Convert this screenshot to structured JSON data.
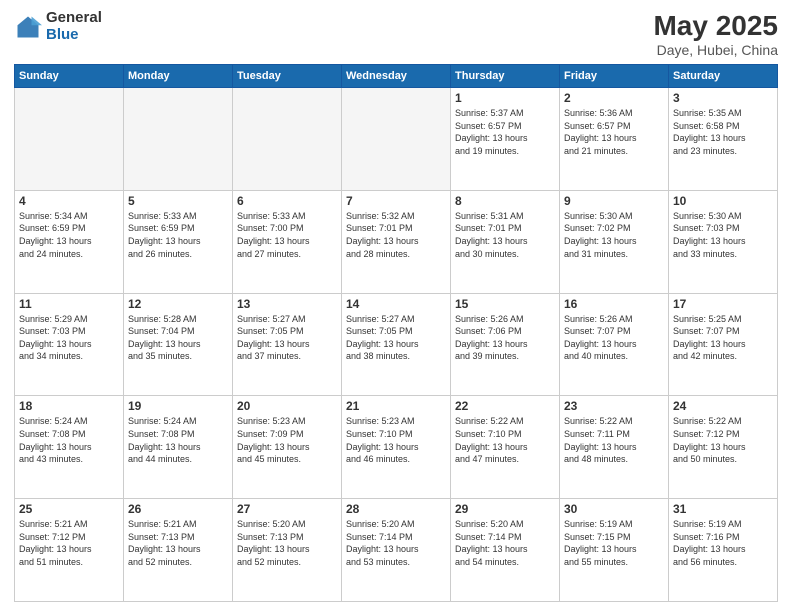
{
  "logo": {
    "general": "General",
    "blue": "Blue"
  },
  "title": "May 2025",
  "subtitle": "Daye, Hubei, China",
  "headers": [
    "Sunday",
    "Monday",
    "Tuesday",
    "Wednesday",
    "Thursday",
    "Friday",
    "Saturday"
  ],
  "weeks": [
    [
      {
        "num": "",
        "info": ""
      },
      {
        "num": "",
        "info": ""
      },
      {
        "num": "",
        "info": ""
      },
      {
        "num": "",
        "info": ""
      },
      {
        "num": "1",
        "info": "Sunrise: 5:37 AM\nSunset: 6:57 PM\nDaylight: 13 hours\nand 19 minutes."
      },
      {
        "num": "2",
        "info": "Sunrise: 5:36 AM\nSunset: 6:57 PM\nDaylight: 13 hours\nand 21 minutes."
      },
      {
        "num": "3",
        "info": "Sunrise: 5:35 AM\nSunset: 6:58 PM\nDaylight: 13 hours\nand 23 minutes."
      }
    ],
    [
      {
        "num": "4",
        "info": "Sunrise: 5:34 AM\nSunset: 6:59 PM\nDaylight: 13 hours\nand 24 minutes."
      },
      {
        "num": "5",
        "info": "Sunrise: 5:33 AM\nSunset: 6:59 PM\nDaylight: 13 hours\nand 26 minutes."
      },
      {
        "num": "6",
        "info": "Sunrise: 5:33 AM\nSunset: 7:00 PM\nDaylight: 13 hours\nand 27 minutes."
      },
      {
        "num": "7",
        "info": "Sunrise: 5:32 AM\nSunset: 7:01 PM\nDaylight: 13 hours\nand 28 minutes."
      },
      {
        "num": "8",
        "info": "Sunrise: 5:31 AM\nSunset: 7:01 PM\nDaylight: 13 hours\nand 30 minutes."
      },
      {
        "num": "9",
        "info": "Sunrise: 5:30 AM\nSunset: 7:02 PM\nDaylight: 13 hours\nand 31 minutes."
      },
      {
        "num": "10",
        "info": "Sunrise: 5:30 AM\nSunset: 7:03 PM\nDaylight: 13 hours\nand 33 minutes."
      }
    ],
    [
      {
        "num": "11",
        "info": "Sunrise: 5:29 AM\nSunset: 7:03 PM\nDaylight: 13 hours\nand 34 minutes."
      },
      {
        "num": "12",
        "info": "Sunrise: 5:28 AM\nSunset: 7:04 PM\nDaylight: 13 hours\nand 35 minutes."
      },
      {
        "num": "13",
        "info": "Sunrise: 5:27 AM\nSunset: 7:05 PM\nDaylight: 13 hours\nand 37 minutes."
      },
      {
        "num": "14",
        "info": "Sunrise: 5:27 AM\nSunset: 7:05 PM\nDaylight: 13 hours\nand 38 minutes."
      },
      {
        "num": "15",
        "info": "Sunrise: 5:26 AM\nSunset: 7:06 PM\nDaylight: 13 hours\nand 39 minutes."
      },
      {
        "num": "16",
        "info": "Sunrise: 5:26 AM\nSunset: 7:07 PM\nDaylight: 13 hours\nand 40 minutes."
      },
      {
        "num": "17",
        "info": "Sunrise: 5:25 AM\nSunset: 7:07 PM\nDaylight: 13 hours\nand 42 minutes."
      }
    ],
    [
      {
        "num": "18",
        "info": "Sunrise: 5:24 AM\nSunset: 7:08 PM\nDaylight: 13 hours\nand 43 minutes."
      },
      {
        "num": "19",
        "info": "Sunrise: 5:24 AM\nSunset: 7:08 PM\nDaylight: 13 hours\nand 44 minutes."
      },
      {
        "num": "20",
        "info": "Sunrise: 5:23 AM\nSunset: 7:09 PM\nDaylight: 13 hours\nand 45 minutes."
      },
      {
        "num": "21",
        "info": "Sunrise: 5:23 AM\nSunset: 7:10 PM\nDaylight: 13 hours\nand 46 minutes."
      },
      {
        "num": "22",
        "info": "Sunrise: 5:22 AM\nSunset: 7:10 PM\nDaylight: 13 hours\nand 47 minutes."
      },
      {
        "num": "23",
        "info": "Sunrise: 5:22 AM\nSunset: 7:11 PM\nDaylight: 13 hours\nand 48 minutes."
      },
      {
        "num": "24",
        "info": "Sunrise: 5:22 AM\nSunset: 7:12 PM\nDaylight: 13 hours\nand 50 minutes."
      }
    ],
    [
      {
        "num": "25",
        "info": "Sunrise: 5:21 AM\nSunset: 7:12 PM\nDaylight: 13 hours\nand 51 minutes."
      },
      {
        "num": "26",
        "info": "Sunrise: 5:21 AM\nSunset: 7:13 PM\nDaylight: 13 hours\nand 52 minutes."
      },
      {
        "num": "27",
        "info": "Sunrise: 5:20 AM\nSunset: 7:13 PM\nDaylight: 13 hours\nand 52 minutes."
      },
      {
        "num": "28",
        "info": "Sunrise: 5:20 AM\nSunset: 7:14 PM\nDaylight: 13 hours\nand 53 minutes."
      },
      {
        "num": "29",
        "info": "Sunrise: 5:20 AM\nSunset: 7:14 PM\nDaylight: 13 hours\nand 54 minutes."
      },
      {
        "num": "30",
        "info": "Sunrise: 5:19 AM\nSunset: 7:15 PM\nDaylight: 13 hours\nand 55 minutes."
      },
      {
        "num": "31",
        "info": "Sunrise: 5:19 AM\nSunset: 7:16 PM\nDaylight: 13 hours\nand 56 minutes."
      }
    ]
  ]
}
